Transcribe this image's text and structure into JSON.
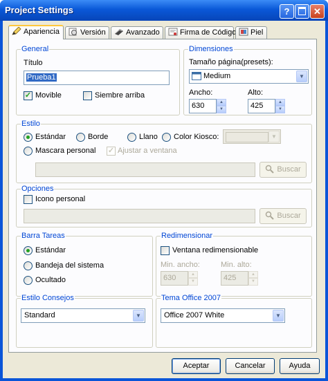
{
  "window": {
    "title": "Project Settings"
  },
  "tabs": [
    {
      "label": "Apariencia",
      "icon": "pencil-icon"
    },
    {
      "label": "Versión",
      "icon": "version-icon"
    },
    {
      "label": "Avanzado",
      "icon": "advanced-icon"
    },
    {
      "label": "Firma de Código",
      "icon": "certificate-icon"
    },
    {
      "label": "Piel",
      "icon": "skin-icon"
    }
  ],
  "general": {
    "legend": "General",
    "title_label": "Título",
    "title_value": "Prueba1",
    "movible_label": "Movible",
    "movible_checked": true,
    "siempre_arriba_label": "Siembre arriba",
    "siempre_arriba_checked": false
  },
  "dimensiones": {
    "legend": "Dimensiones",
    "preset_label": "Tamaño página(presets):",
    "preset_value": "Medium",
    "ancho_label": "Ancho:",
    "ancho_value": "630",
    "alto_label": "Alto:",
    "alto_value": "425"
  },
  "estilo": {
    "legend": "Estilo",
    "estandar": "Estándar",
    "borde": "Borde",
    "llano": "Llano",
    "color_kiosco": "Color Kiosco:",
    "mascara_personal": "Mascara personal",
    "ajustar_ventana": "Ajustar a ventana",
    "selected": "Estándar",
    "buscar": "Buscar"
  },
  "opciones": {
    "legend": "Opciones",
    "icono_personal": "Icono personal",
    "buscar": "Buscar"
  },
  "barra_tareas": {
    "legend": "Barra Tareas",
    "estandar": "Estándar",
    "bandeja": "Bandeja del sistema",
    "ocultado": "Ocultado",
    "selected": "Estándar"
  },
  "redimensionar": {
    "legend": "Redimensionar",
    "ventana_label": "Ventana redimensionable",
    "min_ancho_label": "Min. ancho:",
    "min_ancho_value": "630",
    "min_alto_label": "Min. alto:",
    "min_alto_value": "425"
  },
  "estilo_consejos": {
    "legend": "Estilo Consejos",
    "value": "Standard"
  },
  "tema_office": {
    "legend": "Tema Office 2007",
    "value": "Office 2007 White"
  },
  "buttons": {
    "accept": "Aceptar",
    "cancel": "Cancelar",
    "help": "Ayuda"
  },
  "colors": {
    "title_bar": "#0a55d8",
    "legend": "#0046d5",
    "selection": "#316ac5",
    "check_green": "#21a121"
  }
}
